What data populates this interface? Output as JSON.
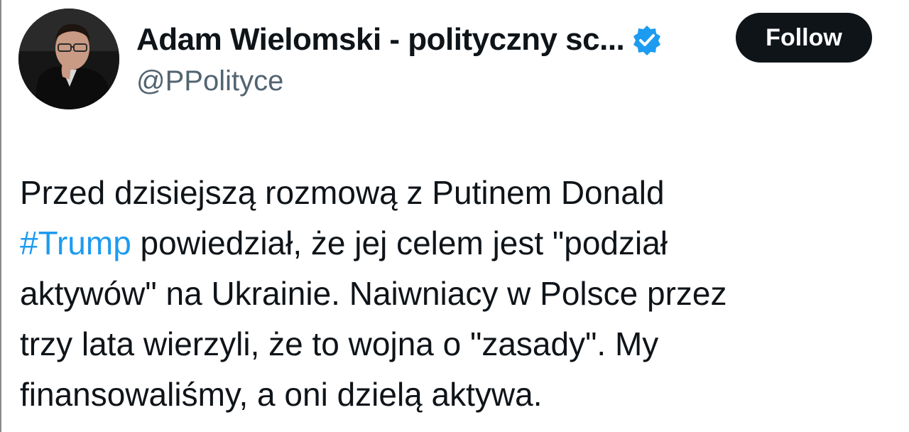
{
  "author": {
    "display_name": "Adam Wielomski - polityczny sc...",
    "handle": "@PPolityce",
    "verified_icon": "verified-badge-icon",
    "avatar": "profile-photo"
  },
  "follow_button": {
    "label": "Follow"
  },
  "tweet": {
    "lines": [
      {
        "text": "Przed dzisiejszą rozmową z Putinem Donald"
      },
      {
        "hashtag": "#Trump",
        "text": " powiedział, że jej celem jest \"podział"
      },
      {
        "text": "aktywów\" na Ukrainie. Naiwniacy w Polsce przez"
      },
      {
        "text": "trzy lata wierzyli, że to wojna o \"zasady\". My"
      },
      {
        "text": "finansowaliśmy, a oni dzielą aktywa."
      }
    ]
  },
  "colors": {
    "text": "#0f1419",
    "secondary": "#536471",
    "link": "#1d9bf0",
    "button_bg": "#0f1419"
  }
}
